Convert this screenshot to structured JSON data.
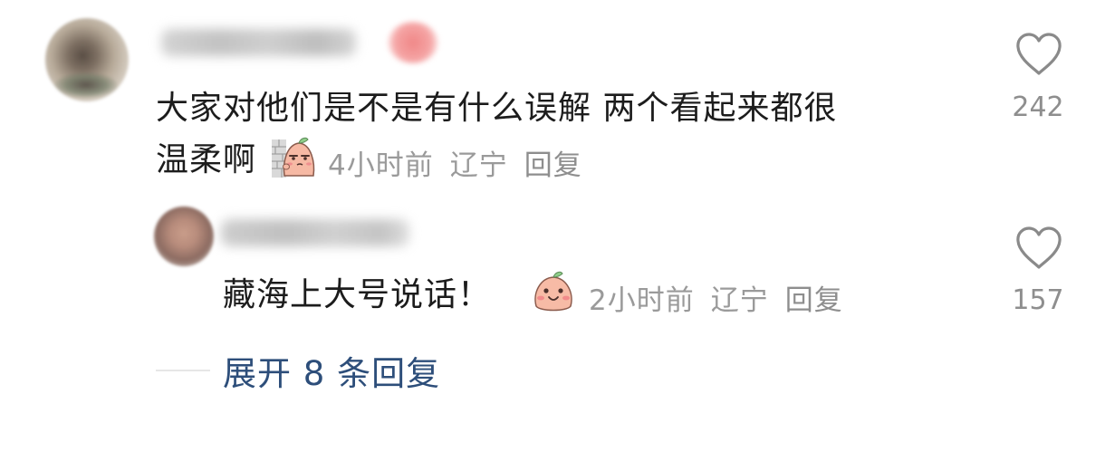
{
  "comments": [
    {
      "text_line1": "大家对他们是不是有什么误解 两个看起来都很",
      "text_line2": "温柔啊",
      "time": "4小时前",
      "location": "辽宁",
      "reply_label": "回复",
      "likes": "242"
    }
  ],
  "replies": [
    {
      "text": "藏海上大号说话！",
      "time": "2小时前",
      "location": "辽宁",
      "reply_label": "回复",
      "likes": "157"
    }
  ],
  "expand": {
    "label": "展开 8 条回复"
  },
  "icons": {
    "like": "heart-outline-icon",
    "sticker_1": "peach-peeking-sticker",
    "sticker_2": "peach-smile-sticker"
  },
  "colors": {
    "text": "#1c1c1c",
    "meta": "#9a9a9a",
    "link": "#2d4e7a"
  }
}
